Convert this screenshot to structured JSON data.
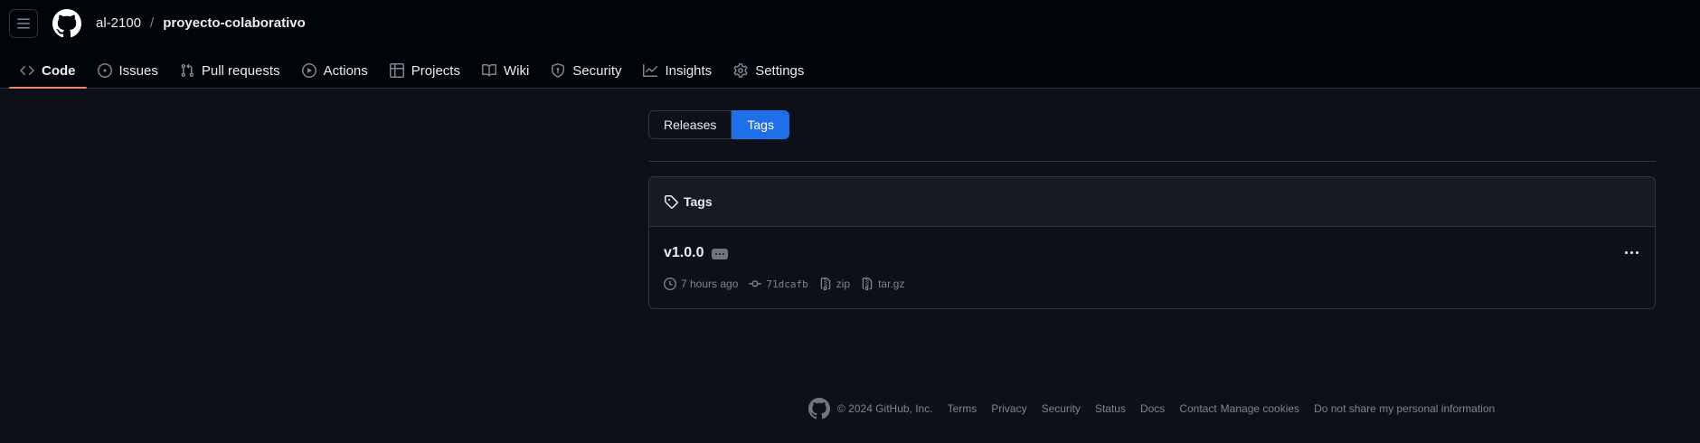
{
  "header": {
    "owner": "al-2100",
    "separator": "/",
    "repo": "proyecto-colaborativo",
    "icons": {
      "menu": "hamburger-icon",
      "logo": "github-logo-icon"
    }
  },
  "nav": {
    "items": [
      {
        "label": "Code",
        "icon": "code-icon"
      },
      {
        "label": "Issues",
        "icon": "issue-icon"
      },
      {
        "label": "Pull requests",
        "icon": "pull-request-icon"
      },
      {
        "label": "Actions",
        "icon": "play-icon"
      },
      {
        "label": "Projects",
        "icon": "table-icon"
      },
      {
        "label": "Wiki",
        "icon": "book-icon"
      },
      {
        "label": "Security",
        "icon": "shield-icon"
      },
      {
        "label": "Insights",
        "icon": "graph-icon"
      },
      {
        "label": "Settings",
        "icon": "gear-icon"
      }
    ],
    "active": "Code"
  },
  "toggle": {
    "releases": "Releases",
    "tags": "Tags",
    "selected": "Tags"
  },
  "tags_panel": {
    "title": "Tags",
    "tags": [
      {
        "name": "v1.0.0",
        "time": "7 hours ago",
        "commit": "71dcafb",
        "zip": "zip",
        "targz": "tar.gz"
      }
    ]
  },
  "footer": {
    "copyright": "© 2024 GitHub, Inc.",
    "links": [
      "Terms",
      "Privacy",
      "Security",
      "Status",
      "Docs",
      "Contact",
      "Manage cookies",
      "Do not share my personal information"
    ]
  },
  "colors": {
    "accent_blue": "#1f6feb",
    "active_underline": "#f78166",
    "background": "#0d1117",
    "header_background": "#010409"
  }
}
